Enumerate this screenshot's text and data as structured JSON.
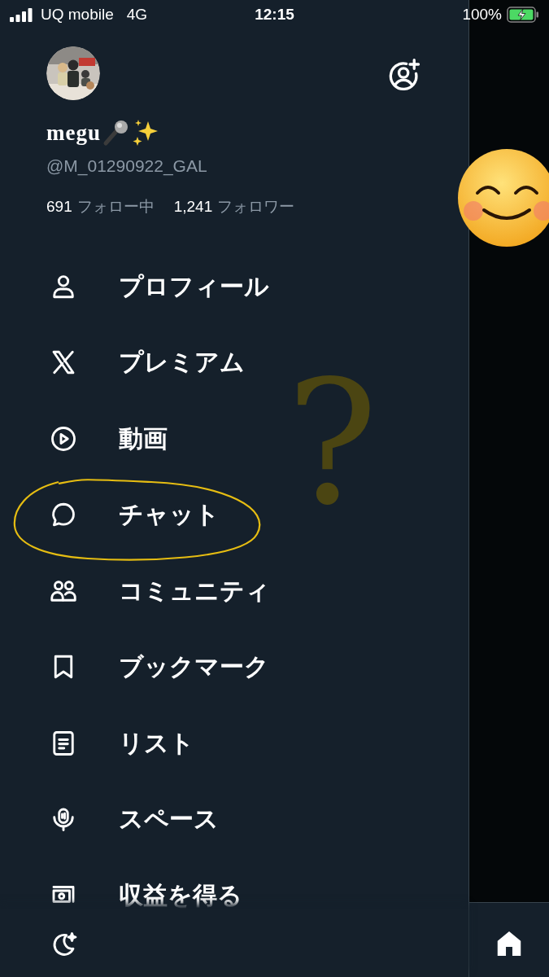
{
  "status_bar": {
    "carrier": "UQ mobile",
    "network": "4G",
    "time": "12:15",
    "battery": "100%"
  },
  "profile": {
    "name": "megu",
    "handle": "@M_01290922_GAL",
    "stats": [
      {
        "count": "691",
        "label": "フォロー中"
      },
      {
        "count": "1,241",
        "label": "フォロワー"
      }
    ]
  },
  "menu": [
    {
      "kind": "profile",
      "label": "プロフィール"
    },
    {
      "kind": "premium",
      "label": "プレミアム"
    },
    {
      "kind": "video",
      "label": "動画"
    },
    {
      "kind": "chat",
      "label": "チャット"
    },
    {
      "kind": "communities",
      "label": "コミュニティ"
    },
    {
      "kind": "bookmarks",
      "label": "ブックマーク"
    },
    {
      "kind": "lists",
      "label": "リスト"
    },
    {
      "kind": "spaces",
      "label": "スペース"
    },
    {
      "kind": "monetization",
      "label": "収益を得る"
    }
  ],
  "annotations": {
    "question_mark": "?"
  }
}
